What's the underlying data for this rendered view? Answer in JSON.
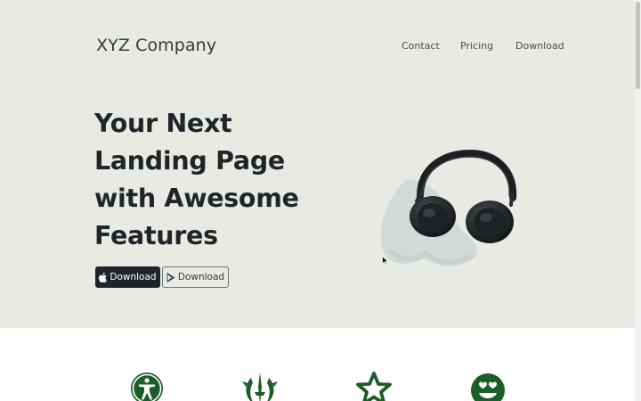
{
  "brand": "XYZ Company",
  "nav": {
    "contact": "Contact",
    "pricing": "Pricing",
    "download": "Download"
  },
  "hero": {
    "headline_lines": [
      "Your Next",
      "Landing Page",
      "with Awesome",
      "Features"
    ],
    "app_store_button": "Download",
    "play_store_button": "Download",
    "image": "headphones-photo"
  },
  "features": {
    "icons": [
      "accessibility-icon",
      "jedi-order-icon",
      "star-outline-icon",
      "grin-hearts-icon"
    ]
  },
  "colors": {
    "hero_background": "#e7ebe4",
    "dark_button": "#212529",
    "feature_icon": "#1b5e2a"
  }
}
